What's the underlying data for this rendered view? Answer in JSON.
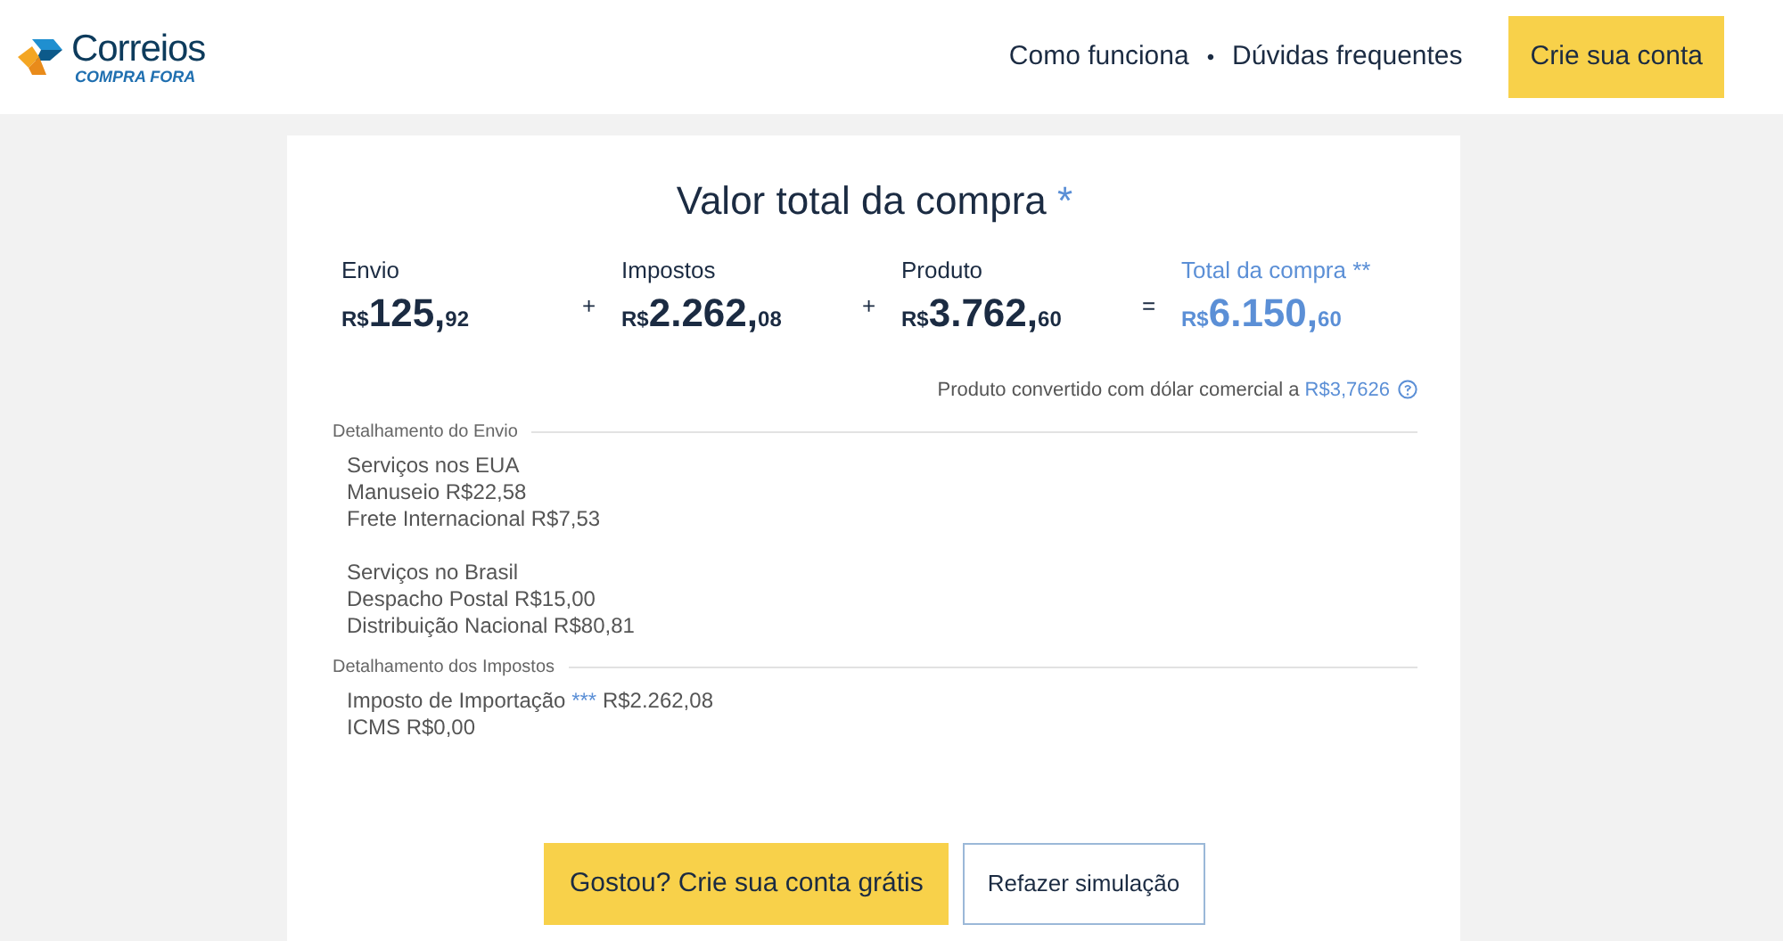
{
  "header": {
    "logo": {
      "name": "Correios",
      "subtitle": "COMPRA FORA"
    },
    "nav": [
      {
        "label": "Como funciona"
      },
      {
        "label": "Dúvidas frequentes"
      }
    ],
    "nav_separator": "•",
    "cta": "Crie sua conta"
  },
  "summary": {
    "title": "Valor total da compra",
    "title_mark": "*",
    "items": [
      {
        "label": "Envio",
        "currency": "R$",
        "whole": "125,",
        "cents": "92",
        "highlight": false,
        "operator": "+"
      },
      {
        "label": "Impostos",
        "currency": "R$",
        "whole": "2.262,",
        "cents": "08",
        "highlight": false,
        "operator": "+"
      },
      {
        "label": "Produto",
        "currency": "R$",
        "whole": "3.762,",
        "cents": "60",
        "highlight": false,
        "operator": "="
      },
      {
        "label": "Total da compra **",
        "currency": "R$",
        "whole": "6.150,",
        "cents": "60",
        "highlight": true
      }
    ],
    "note": "Produto convertido com dólar comercial a",
    "rate": "R$3,7626"
  },
  "sections": [
    {
      "heading": "Detalhamento do Envio",
      "groups": [
        [
          {
            "text": "Serviços nos EUA"
          },
          {
            "text": "Manuseio R$22,58"
          },
          {
            "text": "Frete Internacional R$7,53"
          }
        ],
        [
          {
            "text": "Serviços no Brasil"
          },
          {
            "text": "Despacho Postal R$15,00"
          },
          {
            "text": "Distribuição Nacional R$80,81"
          }
        ]
      ]
    },
    {
      "heading": "Detalhamento dos Impostos",
      "groups": [
        [
          {
            "text": "Imposto de Importação",
            "mark": "***",
            "value": "R$2.262,08"
          },
          {
            "text": "ICMS R$0,00"
          }
        ]
      ]
    }
  ],
  "buttons": [
    {
      "label": "Gostou? Crie sua conta grátis",
      "kind": "primary"
    },
    {
      "label": "Refazer simulação",
      "kind": "secondary"
    }
  ]
}
